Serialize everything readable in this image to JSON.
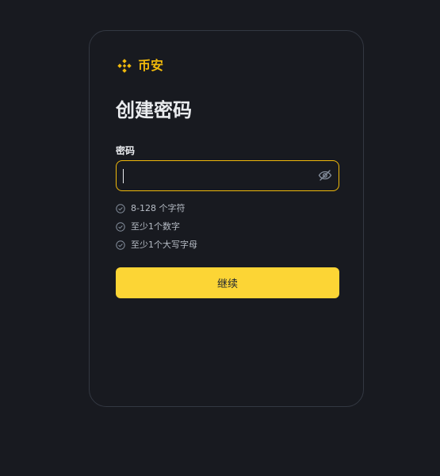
{
  "brand": {
    "name": "币安",
    "logo_icon": "binance-logo-icon",
    "color": "#f0b90b"
  },
  "page": {
    "title": "创建密码"
  },
  "password": {
    "label": "密码",
    "value": "",
    "placeholder": "",
    "toggle_icon": "eye-slash-icon"
  },
  "rules": [
    {
      "text": "8-128 个字符",
      "icon": "check-circle-icon"
    },
    {
      "text": "至少1个数字",
      "icon": "check-circle-icon"
    },
    {
      "text": "至少1个大写字母",
      "icon": "check-circle-icon"
    }
  ],
  "actions": {
    "continue_label": "继续",
    "continue_color": "#fcd535"
  },
  "colors": {
    "background": "#181a20",
    "card_border": "#333842",
    "focus_border": "#f0b90b",
    "text_primary": "#eaecef",
    "text_secondary": "#b7bdc6"
  }
}
